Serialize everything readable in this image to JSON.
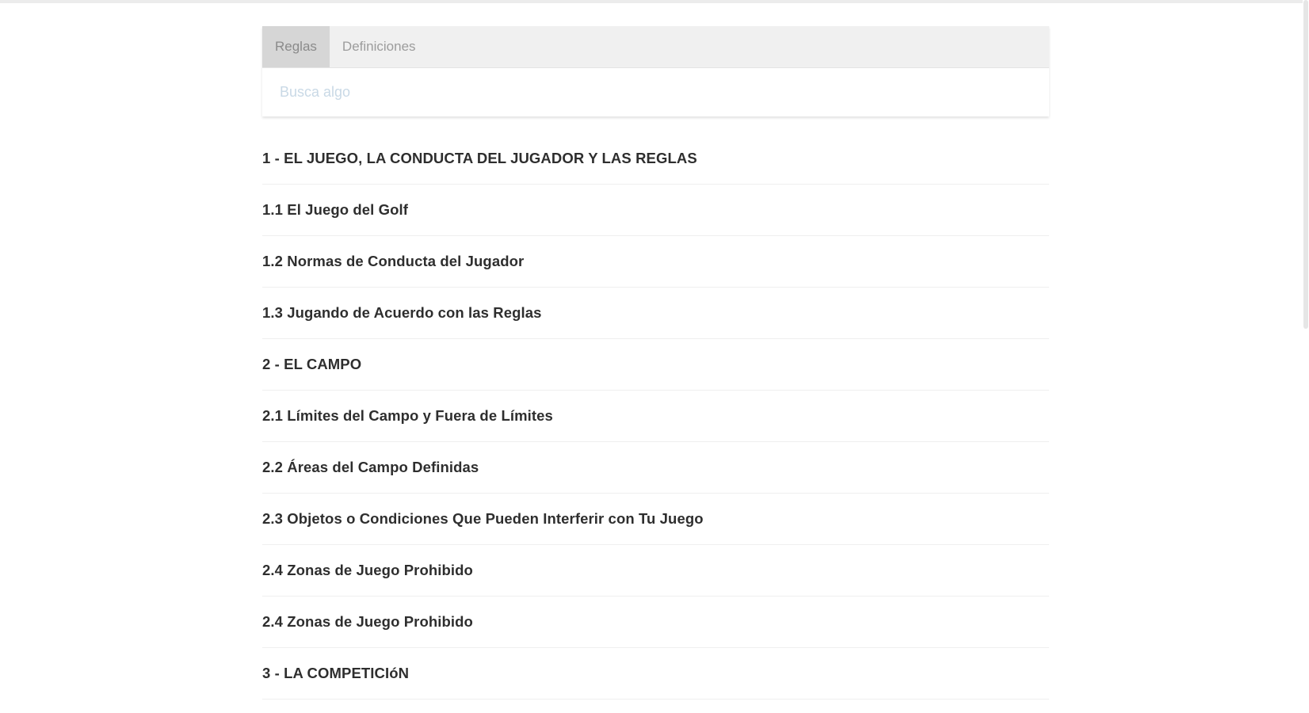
{
  "tabs": [
    {
      "label": "Reglas",
      "active": true
    },
    {
      "label": "Definiciones",
      "active": false
    }
  ],
  "search": {
    "placeholder": "Busca algo",
    "value": ""
  },
  "rules": [
    "1 - EL JUEGO, LA CONDUCTA DEL JUGADOR Y LAS REGLAS",
    "1.1 El Juego del Golf",
    "1.2 Normas de Conducta del Jugador",
    "1.3 Jugando de Acuerdo con las Reglas",
    "2 - EL CAMPO",
    "2.1 Límites del Campo y Fuera de Límites",
    "2.2 Áreas del Campo Definidas",
    "2.3 Objetos o Condiciones Que Pueden Interferir con Tu Juego",
    "2.4 Zonas de Juego Prohibido",
    "2.4 Zonas de Juego Prohibido",
    "3 - LA COMPETICIóN"
  ],
  "colors": {
    "tab_bar_bg": "#f0f0f0",
    "active_tab_bg": "#d6d6d6",
    "rule_text": "#2e2e2e",
    "placeholder": "#c9d9e6"
  }
}
